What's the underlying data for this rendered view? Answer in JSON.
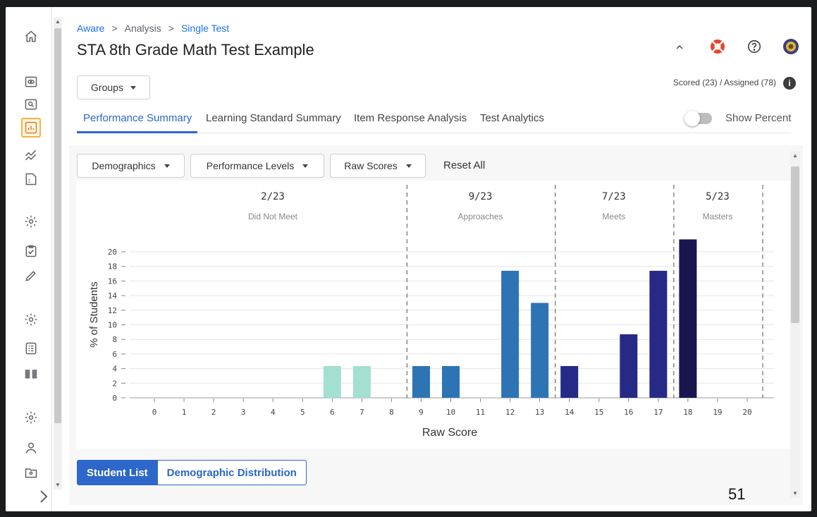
{
  "breadcrumb": [
    {
      "label": "Aware",
      "link": true
    },
    {
      "label": "Analysis",
      "link": false
    },
    {
      "label": "Single Test",
      "link": true
    }
  ],
  "breadcrumb_sep": ">",
  "title": "STA 8th Grade Math Test Example",
  "header_icons": [
    "chevron-up-icon",
    "lifebuoy-icon",
    "help-icon",
    "avatar"
  ],
  "groups_label": "Groups",
  "scored_text": "Scored (23) / Assigned (78)",
  "tabs": [
    {
      "label": "Performance Summary",
      "active": true
    },
    {
      "label": "Learning Standard Summary",
      "active": false
    },
    {
      "label": "Item Response Analysis",
      "active": false
    },
    {
      "label": "Test Analytics",
      "active": false
    }
  ],
  "show_percent_label": "Show Percent",
  "show_percent_on": false,
  "filters": [
    {
      "label": "Demographics"
    },
    {
      "label": "Performance Levels"
    },
    {
      "label": "Raw Scores"
    }
  ],
  "reset_label": "Reset All",
  "chart_data": {
    "type": "bar",
    "xlabel": "Raw Score",
    "ylabel": "% of Students",
    "ylim": [
      0,
      20
    ],
    "yticks": [
      0,
      2,
      4,
      6,
      8,
      10,
      12,
      14,
      16,
      18,
      20
    ],
    "categories": [
      "0",
      "1",
      "2",
      "3",
      "4",
      "5",
      "6",
      "7",
      "8",
      "9",
      "10",
      "11",
      "12",
      "13",
      "14",
      "15",
      "16",
      "17",
      "18",
      "19",
      "20"
    ],
    "values": [
      0,
      0,
      0,
      0,
      0,
      0,
      4.35,
      4.35,
      0,
      4.35,
      4.35,
      0,
      17.4,
      13.0,
      4.35,
      0,
      8.7,
      17.4,
      21.7,
      0,
      0
    ],
    "grid": true,
    "levels": [
      {
        "count": "2/23",
        "name": "Did Not Meet",
        "from": 0,
        "to": 8,
        "color": "#a3e0cf"
      },
      {
        "count": "9/23",
        "name": "Approaches",
        "from": 9,
        "to": 13,
        "color": "#2d74b5"
      },
      {
        "count": "7/23",
        "name": "Meets",
        "from": 14,
        "to": 17,
        "color": "#262a86"
      },
      {
        "count": "5/23",
        "name": "Masters",
        "from": 18,
        "to": 20,
        "color": "#19164f"
      }
    ]
  },
  "segments": [
    {
      "label": "Student List",
      "active": true
    },
    {
      "label": "Demographic Distribution",
      "active": false
    }
  ],
  "page_number": "51",
  "colors": {
    "accent": "#2c67c9",
    "active_nav": "#f2b441"
  }
}
